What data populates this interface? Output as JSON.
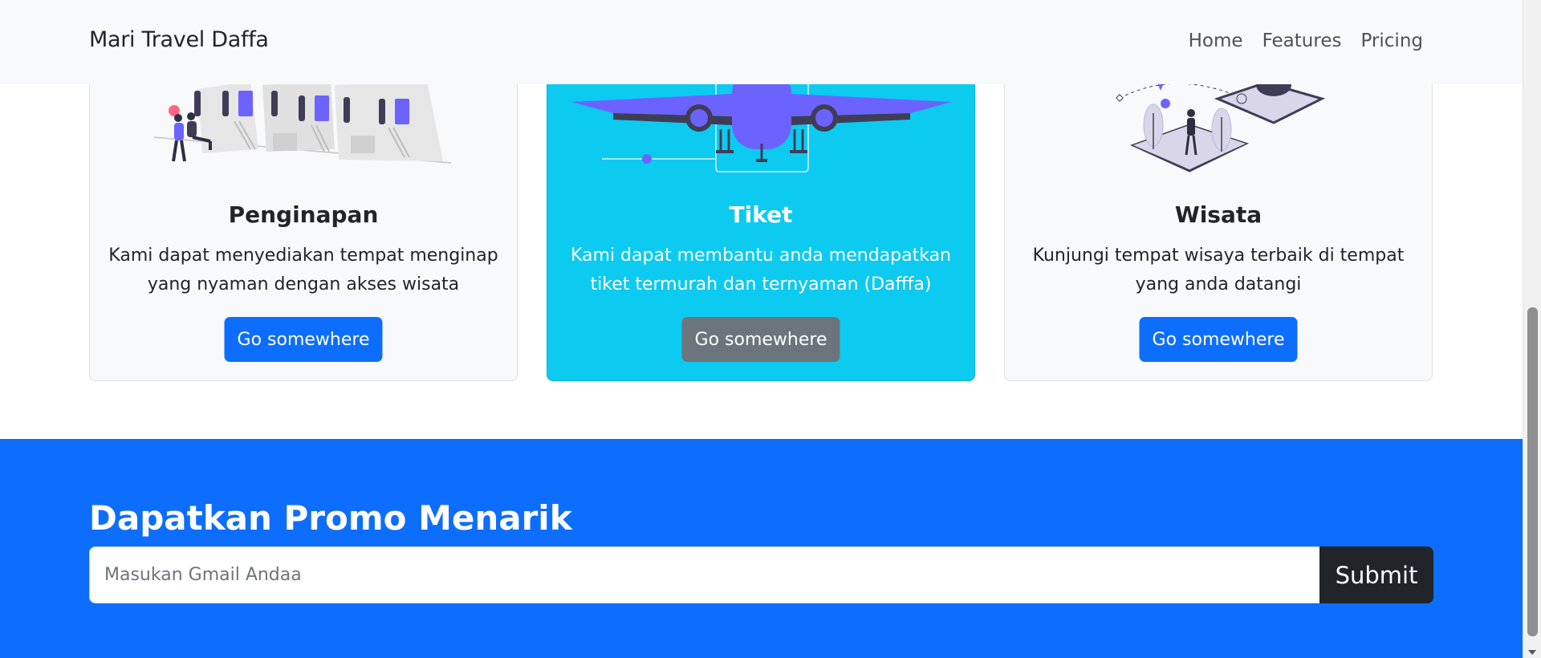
{
  "navbar": {
    "brand": "Mari Travel Daffa",
    "links": [
      "Home",
      "Features",
      "Pricing"
    ]
  },
  "cards": [
    {
      "title": "Penginapan",
      "text": "Kami dapat menyediakan tempat menginap yang nyaman dengan akses wisata",
      "button": "Go somewhere"
    },
    {
      "title": "Tiket",
      "text": "Kami dapat membantu anda mendapatkan tiket termurah dan ternyaman (Dafffa)",
      "button": "Go somewhere"
    },
    {
      "title": "Wisata",
      "text": "Kunjungi tempat wisaya terbaik di tempat yang anda datangi",
      "button": "Go somewhere"
    }
  ],
  "promo": {
    "title": "Dapatkan Promo Menarik",
    "email_placeholder": "Masukan Gmail Andaa",
    "email_value": "",
    "submit_label": "Submit"
  },
  "colors": {
    "primary": "#0d6efd",
    "info": "#0dcaf0",
    "secondary": "#6c757d",
    "dark": "#212529",
    "illustration_accent": "#6c63ff"
  }
}
